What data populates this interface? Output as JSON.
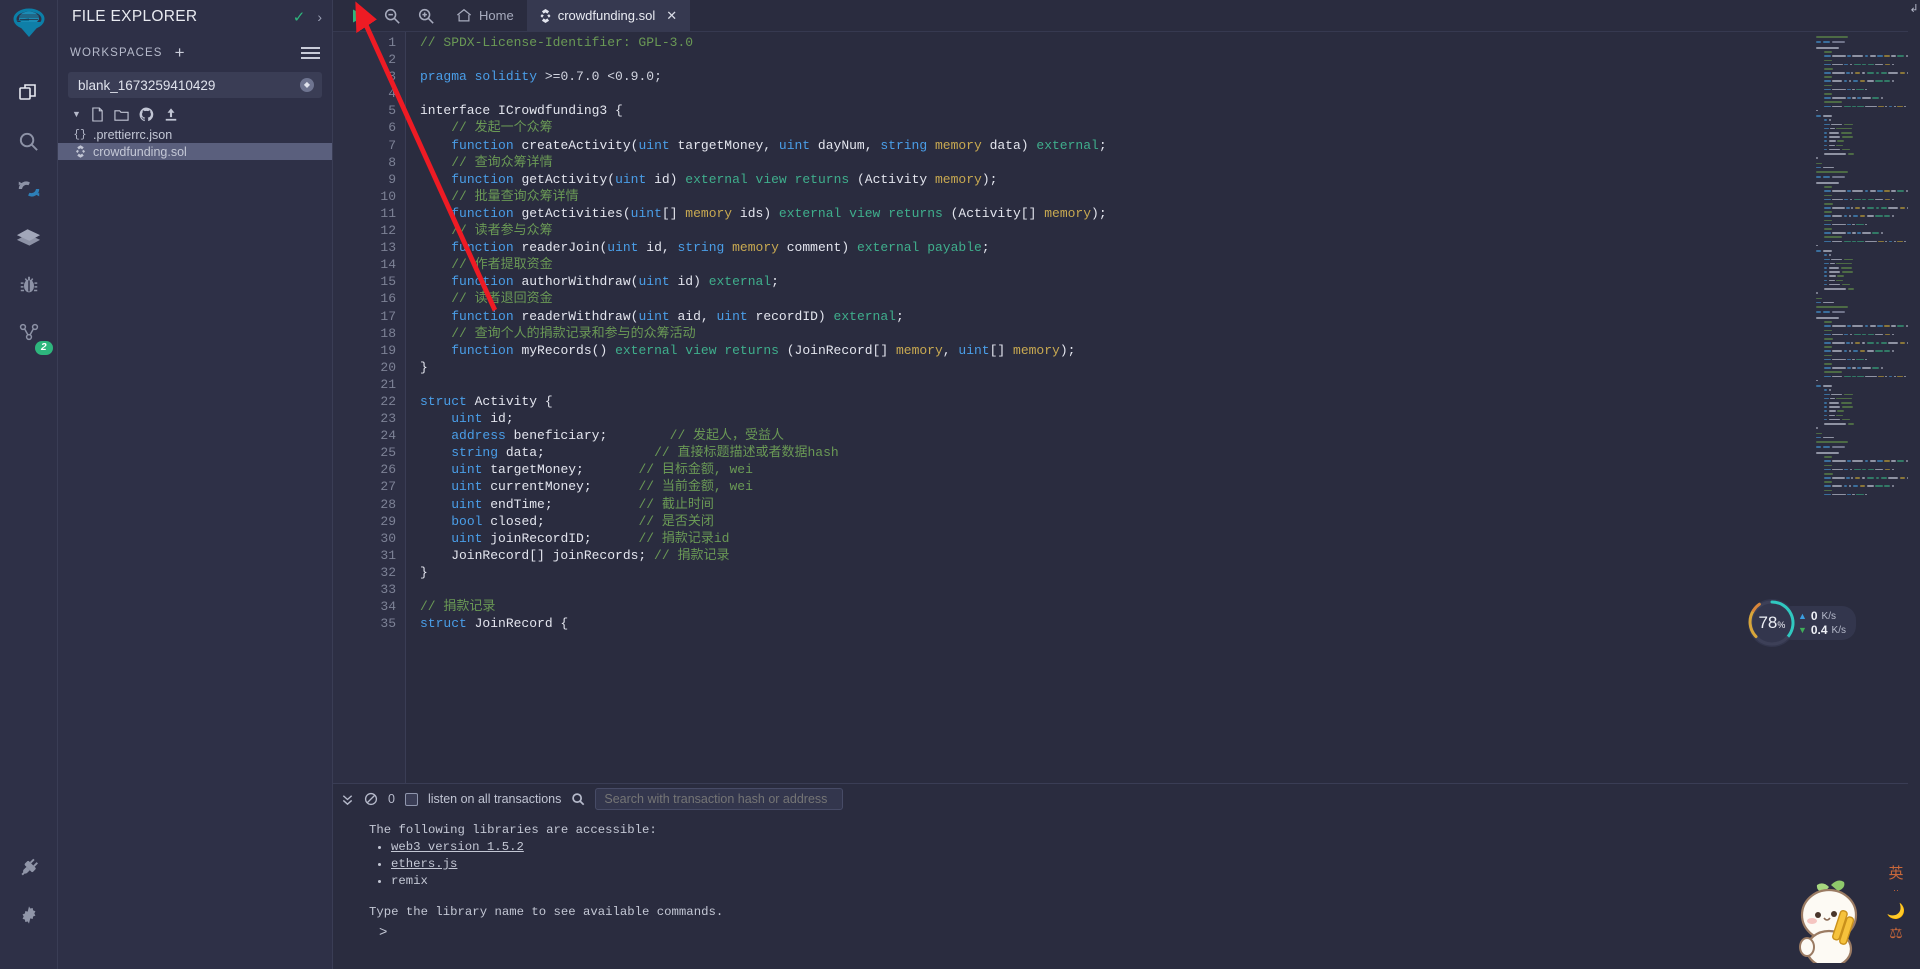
{
  "iconbar": {
    "items": [
      {
        "name": "remix-logo-icon",
        "label": "Remix"
      },
      {
        "name": "file-explorer-icon",
        "label": "File explorer"
      },
      {
        "name": "search-icon",
        "label": "Search in files"
      },
      {
        "name": "solidity-compiler-icon",
        "label": "Solidity compiler"
      },
      {
        "name": "deploy-run-icon",
        "label": "Deploy & run transactions"
      },
      {
        "name": "debugger-icon",
        "label": "Debugger"
      },
      {
        "name": "plugin-manager-icon",
        "label": "Plugin manager",
        "badge": "2"
      }
    ],
    "bottom": [
      {
        "name": "plugin-plug-icon",
        "label": "Plugins"
      },
      {
        "name": "settings-gear-icon",
        "label": "Settings"
      }
    ]
  },
  "explorer": {
    "title": "FILE EXPLORER",
    "workspaces_label": "WORKSPACES",
    "plus_label": "+",
    "current_workspace": "blank_1673259410429",
    "files": [
      {
        "name": ".prettierrc.json",
        "icon": "json-braces-icon",
        "selected": false
      },
      {
        "name": "crowdfunding.sol",
        "icon": "solidity-file-icon",
        "selected": true
      }
    ]
  },
  "toolbar": {
    "run_label": "Run",
    "zoom_out_label": "Zoom out",
    "zoom_in_label": "Zoom in",
    "tabs": [
      {
        "label": "Home",
        "icon": "home-icon",
        "active": false,
        "closable": false
      },
      {
        "label": "crowdfunding.sol",
        "icon": "solidity-file-icon",
        "active": true,
        "closable": true,
        "close_label": "✕"
      }
    ]
  },
  "editor": {
    "first_line": 1,
    "lines": [
      {
        "n": 1,
        "tokens": [
          {
            "t": "// SPDX-License-Identifier: GPL-3.0",
            "c": "c-com"
          }
        ]
      },
      {
        "n": 2,
        "tokens": []
      },
      {
        "n": 3,
        "tokens": [
          {
            "t": "pragma",
            "c": "c-key"
          },
          {
            "t": " ",
            "c": "c-pln"
          },
          {
            "t": "solidity",
            "c": "c-key"
          },
          {
            "t": " >=0.7.0 <0.9.0;",
            "c": "c-pln"
          }
        ]
      },
      {
        "n": 4,
        "tokens": []
      },
      {
        "n": 5,
        "tokens": [
          {
            "t": "interface ICrowdfunding3 {",
            "c": "c-white"
          }
        ]
      },
      {
        "n": 6,
        "tokens": [
          {
            "t": "    // 发起一个众筹",
            "c": "c-com"
          }
        ]
      },
      {
        "n": 7,
        "tokens": [
          {
            "t": "    ",
            "c": "c-pln"
          },
          {
            "t": "function",
            "c": "c-key"
          },
          {
            "t": " createActivity(",
            "c": "c-white"
          },
          {
            "t": "uint",
            "c": "c-type"
          },
          {
            "t": " targetMoney, ",
            "c": "c-white"
          },
          {
            "t": "uint",
            "c": "c-type"
          },
          {
            "t": " dayNum, ",
            "c": "c-white"
          },
          {
            "t": "string",
            "c": "c-type"
          },
          {
            "t": " ",
            "c": "c-pln"
          },
          {
            "t": "memory",
            "c": "c-mem"
          },
          {
            "t": " data) ",
            "c": "c-white"
          },
          {
            "t": "external",
            "c": "c-mod"
          },
          {
            "t": ";",
            "c": "c-white"
          }
        ]
      },
      {
        "n": 8,
        "tokens": [
          {
            "t": "    // 查询众筹详情",
            "c": "c-com"
          }
        ]
      },
      {
        "n": 9,
        "tokens": [
          {
            "t": "    ",
            "c": "c-pln"
          },
          {
            "t": "function",
            "c": "c-key"
          },
          {
            "t": " getActivity(",
            "c": "c-white"
          },
          {
            "t": "uint",
            "c": "c-type"
          },
          {
            "t": " id) ",
            "c": "c-white"
          },
          {
            "t": "external",
            "c": "c-mod"
          },
          {
            "t": " ",
            "c": "c-pln"
          },
          {
            "t": "view",
            "c": "c-mod"
          },
          {
            "t": " ",
            "c": "c-pln"
          },
          {
            "t": "returns",
            "c": "c-mod"
          },
          {
            "t": " (Activity ",
            "c": "c-white"
          },
          {
            "t": "memory",
            "c": "c-mem"
          },
          {
            "t": ");",
            "c": "c-white"
          }
        ]
      },
      {
        "n": 10,
        "tokens": [
          {
            "t": "    // 批量查询众筹详情",
            "c": "c-com"
          }
        ]
      },
      {
        "n": 11,
        "tokens": [
          {
            "t": "    ",
            "c": "c-pln"
          },
          {
            "t": "function",
            "c": "c-key"
          },
          {
            "t": " getActivities(",
            "c": "c-white"
          },
          {
            "t": "uint",
            "c": "c-type"
          },
          {
            "t": "[] ",
            "c": "c-white"
          },
          {
            "t": "memory",
            "c": "c-mem"
          },
          {
            "t": " ids) ",
            "c": "c-white"
          },
          {
            "t": "external",
            "c": "c-mod"
          },
          {
            "t": " ",
            "c": "c-pln"
          },
          {
            "t": "view",
            "c": "c-mod"
          },
          {
            "t": " ",
            "c": "c-pln"
          },
          {
            "t": "returns",
            "c": "c-mod"
          },
          {
            "t": " (Activity[] ",
            "c": "c-white"
          },
          {
            "t": "memory",
            "c": "c-mem"
          },
          {
            "t": ");",
            "c": "c-white"
          }
        ]
      },
      {
        "n": 12,
        "tokens": [
          {
            "t": "    // 读者参与众筹",
            "c": "c-com"
          }
        ]
      },
      {
        "n": 13,
        "tokens": [
          {
            "t": "    ",
            "c": "c-pln"
          },
          {
            "t": "function",
            "c": "c-key"
          },
          {
            "t": " readerJoin(",
            "c": "c-white"
          },
          {
            "t": "uint",
            "c": "c-type"
          },
          {
            "t": " id, ",
            "c": "c-white"
          },
          {
            "t": "string",
            "c": "c-type"
          },
          {
            "t": " ",
            "c": "c-pln"
          },
          {
            "t": "memory",
            "c": "c-mem"
          },
          {
            "t": " comment) ",
            "c": "c-white"
          },
          {
            "t": "external",
            "c": "c-mod"
          },
          {
            "t": " ",
            "c": "c-pln"
          },
          {
            "t": "payable",
            "c": "c-mod"
          },
          {
            "t": ";",
            "c": "c-white"
          }
        ]
      },
      {
        "n": 14,
        "tokens": [
          {
            "t": "    // 作者提取资金",
            "c": "c-com"
          }
        ]
      },
      {
        "n": 15,
        "tokens": [
          {
            "t": "    ",
            "c": "c-pln"
          },
          {
            "t": "function",
            "c": "c-key"
          },
          {
            "t": " authorWithdraw(",
            "c": "c-white"
          },
          {
            "t": "uint",
            "c": "c-type"
          },
          {
            "t": " id) ",
            "c": "c-white"
          },
          {
            "t": "external",
            "c": "c-mod"
          },
          {
            "t": ";",
            "c": "c-white"
          }
        ]
      },
      {
        "n": 16,
        "tokens": [
          {
            "t": "    // 读者退回资金",
            "c": "c-com"
          }
        ]
      },
      {
        "n": 17,
        "tokens": [
          {
            "t": "    ",
            "c": "c-pln"
          },
          {
            "t": "function",
            "c": "c-key"
          },
          {
            "t": " readerWithdraw(",
            "c": "c-white"
          },
          {
            "t": "uint",
            "c": "c-type"
          },
          {
            "t": " aid, ",
            "c": "c-white"
          },
          {
            "t": "uint",
            "c": "c-type"
          },
          {
            "t": " recordID) ",
            "c": "c-white"
          },
          {
            "t": "external",
            "c": "c-mod"
          },
          {
            "t": ";",
            "c": "c-white"
          }
        ]
      },
      {
        "n": 18,
        "tokens": [
          {
            "t": "    // 查询个人的捐款记录和参与的众筹活动",
            "c": "c-com"
          }
        ]
      },
      {
        "n": 19,
        "tokens": [
          {
            "t": "    ",
            "c": "c-pln"
          },
          {
            "t": "function",
            "c": "c-key"
          },
          {
            "t": " myRecords() ",
            "c": "c-white"
          },
          {
            "t": "external",
            "c": "c-mod"
          },
          {
            "t": " ",
            "c": "c-pln"
          },
          {
            "t": "view",
            "c": "c-mod"
          },
          {
            "t": " ",
            "c": "c-pln"
          },
          {
            "t": "returns",
            "c": "c-mod"
          },
          {
            "t": " (JoinRecord[] ",
            "c": "c-white"
          },
          {
            "t": "memory",
            "c": "c-mem"
          },
          {
            "t": ", ",
            "c": "c-white"
          },
          {
            "t": "uint",
            "c": "c-type"
          },
          {
            "t": "[] ",
            "c": "c-white"
          },
          {
            "t": "memory",
            "c": "c-mem"
          },
          {
            "t": ");",
            "c": "c-white"
          }
        ]
      },
      {
        "n": 20,
        "tokens": [
          {
            "t": "}",
            "c": "c-white"
          }
        ]
      },
      {
        "n": 21,
        "tokens": []
      },
      {
        "n": 22,
        "tokens": [
          {
            "t": "struct",
            "c": "c-key"
          },
          {
            "t": " Activity {",
            "c": "c-white"
          }
        ]
      },
      {
        "n": 23,
        "tokens": [
          {
            "t": "    ",
            "c": "c-pln"
          },
          {
            "t": "uint",
            "c": "c-type"
          },
          {
            "t": " id;",
            "c": "c-white"
          }
        ]
      },
      {
        "n": 24,
        "tokens": [
          {
            "t": "    ",
            "c": "c-pln"
          },
          {
            "t": "address",
            "c": "c-type"
          },
          {
            "t": " beneficiary;        ",
            "c": "c-white"
          },
          {
            "t": "// 发起人，受益人",
            "c": "c-com"
          }
        ]
      },
      {
        "n": 25,
        "tokens": [
          {
            "t": "    ",
            "c": "c-pln"
          },
          {
            "t": "string",
            "c": "c-type"
          },
          {
            "t": " data;              ",
            "c": "c-white"
          },
          {
            "t": "// 直接标题描述或者数据hash",
            "c": "c-com"
          }
        ]
      },
      {
        "n": 26,
        "tokens": [
          {
            "t": "    ",
            "c": "c-pln"
          },
          {
            "t": "uint",
            "c": "c-type"
          },
          {
            "t": " targetMoney;       ",
            "c": "c-white"
          },
          {
            "t": "// 目标金额, wei",
            "c": "c-com"
          }
        ]
      },
      {
        "n": 27,
        "tokens": [
          {
            "t": "    ",
            "c": "c-pln"
          },
          {
            "t": "uint",
            "c": "c-type"
          },
          {
            "t": " currentMoney;      ",
            "c": "c-white"
          },
          {
            "t": "// 当前金额, wei",
            "c": "c-com"
          }
        ]
      },
      {
        "n": 28,
        "tokens": [
          {
            "t": "    ",
            "c": "c-pln"
          },
          {
            "t": "uint",
            "c": "c-type"
          },
          {
            "t": " endTime;           ",
            "c": "c-white"
          },
          {
            "t": "// 截止时间",
            "c": "c-com"
          }
        ]
      },
      {
        "n": 29,
        "tokens": [
          {
            "t": "    ",
            "c": "c-pln"
          },
          {
            "t": "bool",
            "c": "c-type"
          },
          {
            "t": " closed;            ",
            "c": "c-white"
          },
          {
            "t": "// 是否关闭",
            "c": "c-com"
          }
        ]
      },
      {
        "n": 30,
        "tokens": [
          {
            "t": "    ",
            "c": "c-pln"
          },
          {
            "t": "uint",
            "c": "c-type"
          },
          {
            "t": " joinRecordID;      ",
            "c": "c-white"
          },
          {
            "t": "// 捐款记录id",
            "c": "c-com"
          }
        ]
      },
      {
        "n": 31,
        "tokens": [
          {
            "t": "    JoinRecord[] joinRecords; ",
            "c": "c-white"
          },
          {
            "t": "// 捐款记录",
            "c": "c-com"
          }
        ]
      },
      {
        "n": 32,
        "tokens": [
          {
            "t": "}",
            "c": "c-white"
          }
        ]
      },
      {
        "n": 33,
        "tokens": []
      },
      {
        "n": 34,
        "tokens": [
          {
            "t": "// 捐款记录",
            "c": "c-com"
          }
        ]
      },
      {
        "n": 35,
        "tokens": [
          {
            "t": "struct",
            "c": "c-key"
          },
          {
            "t": " JoinRecord {",
            "c": "c-white"
          }
        ]
      }
    ]
  },
  "terminal": {
    "chevron_label": "»",
    "clear_label": "⊘",
    "count": "0",
    "listen_label": "listen on all transactions",
    "search_placeholder": "Search with transaction hash or address",
    "output_intro": "The following libraries are accessible:",
    "output_libs": [
      "web3 version 1.5.2",
      "ethers.js",
      "remix"
    ],
    "output_hint": "Type the library name to see available commands.",
    "prompt": ">"
  },
  "speed_widget": {
    "percent": "78",
    "percent_unit": "%",
    "upload_value": "0",
    "upload_unit": "K/s",
    "download_value": "0.4",
    "download_unit": "K/s"
  },
  "ime": {
    "mode": "英",
    "dots": "··"
  },
  "colors": {
    "accent_green": "#2eb67d",
    "annotation_red": "#ee1b24",
    "panel_bg": "#2e3047",
    "editor_bg": "#2a2c3f",
    "selection_bg": "#5a5f7d"
  }
}
